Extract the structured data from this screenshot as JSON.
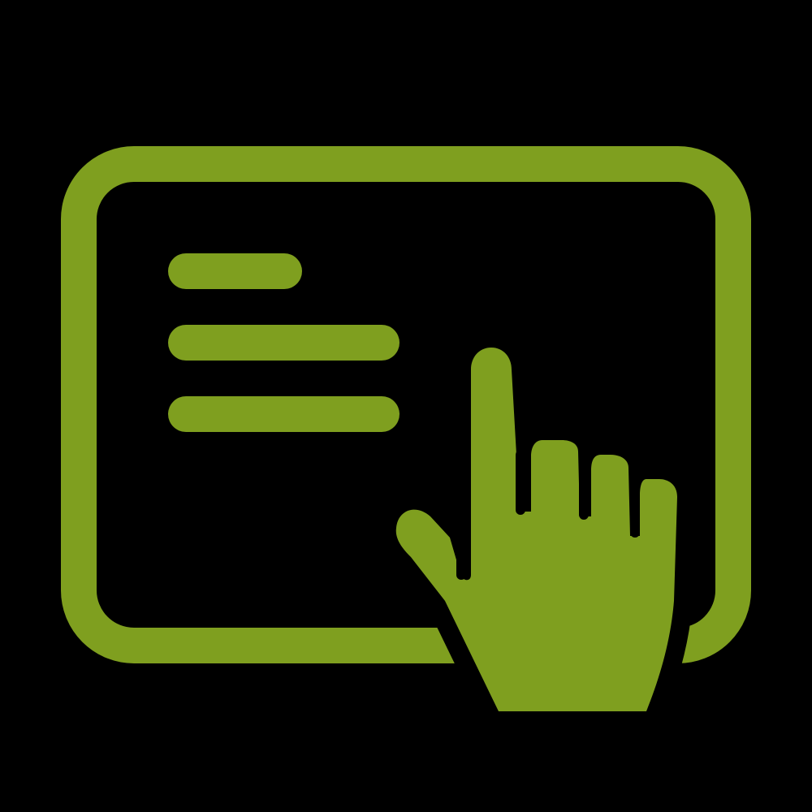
{
  "icon": {
    "name": "touch-screen-icon",
    "background_color": "#000000",
    "accent_color": "#7f9f1f",
    "parts": [
      "tablet-frame",
      "text-lines",
      "pointing-hand"
    ]
  }
}
